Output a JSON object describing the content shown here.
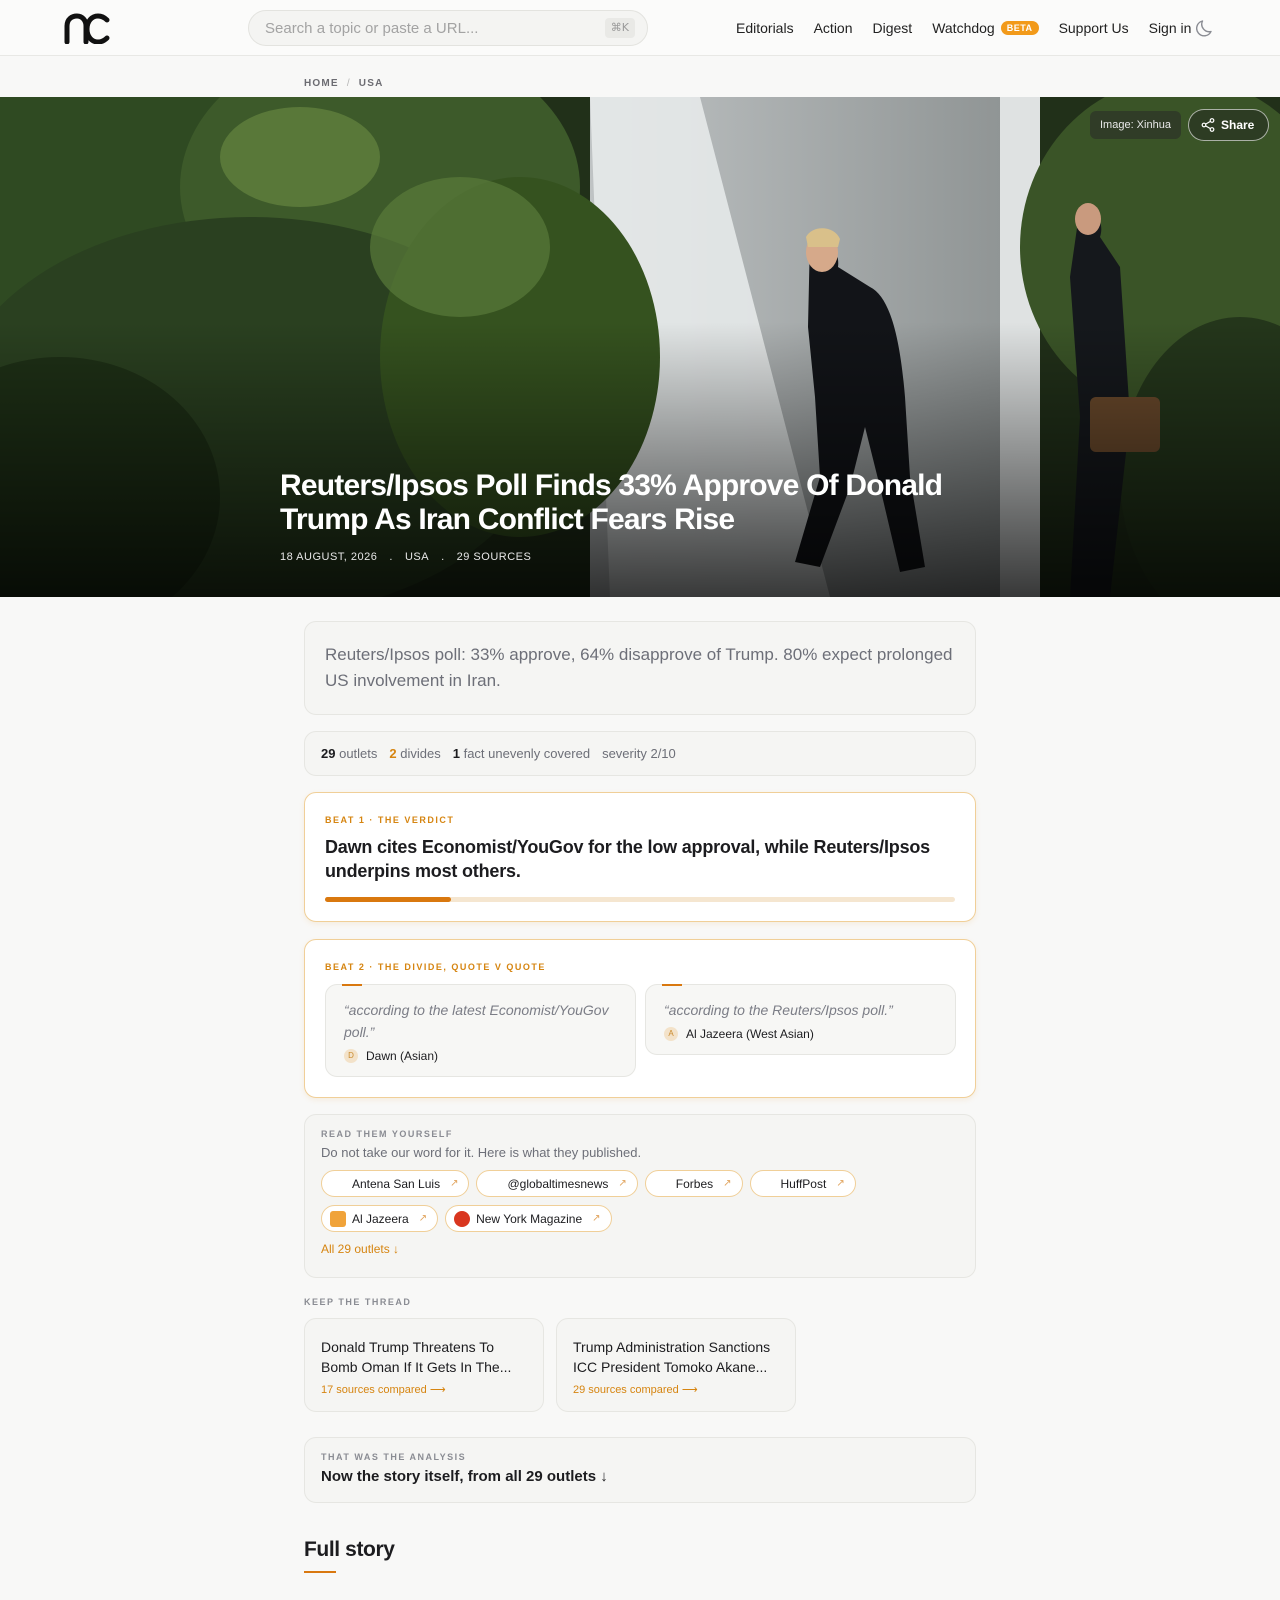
{
  "header": {
    "logo_text": "nc",
    "search_placeholder": "Search a topic or paste a URL...",
    "search_shortcut": "⌘K",
    "nav": [
      {
        "label": "Editorials"
      },
      {
        "label": "Action"
      },
      {
        "label": "Digest"
      },
      {
        "label": "Watchdog",
        "badge": "BETA"
      },
      {
        "label": "Support Us"
      },
      {
        "label": "Sign in"
      }
    ],
    "theme_icon": "moon-icon"
  },
  "breadcrumb": [
    "HOME",
    "/",
    "USA"
  ],
  "hero": {
    "image_credit": "Image: Xinhua",
    "share_label": "Share",
    "title": "Reuters/Ipsos Poll Finds 33% Approve Of Donald Trump As Iran Conflict Fears Rise",
    "meta": [
      "18 AUGUST, 2026",
      ".",
      "USA",
      ".",
      "29 SOURCES"
    ]
  },
  "summary": "Reuters/Ipsos poll: 33% approve, 64% disapprove of Trump. 80% expect prolonged US involvement in Iran.",
  "stats": {
    "outlets_count": "29",
    "outlets_label": "outlets",
    "divides_count": "2",
    "divides_label": "divides",
    "facts_count": "1",
    "facts_label": "fact unevenly covered",
    "severity": "severity 2/10"
  },
  "beat1": {
    "label": "BEAT 1 · THE VERDICT",
    "text": "Dawn cites Economist/YouGov for the low approval, while Reuters/Ipsos underpins most others.",
    "progress": 0.2
  },
  "beat2": {
    "label": "BEAT 2 · THE DIVIDE, QUOTE V QUOTE",
    "quotes": [
      {
        "text": "“according to the latest Economist/YouGov poll.”",
        "source": "Dawn (Asian)",
        "initial": "D"
      },
      {
        "text": "“according to the Reuters/Ipsos poll.”",
        "source": "Al Jazeera (West Asian)",
        "initial": "A"
      }
    ]
  },
  "read": {
    "label": "READ THEM YOURSELF",
    "subtitle": "Do not take our word for it. Here is what they published.",
    "outlets": [
      {
        "name": "Antena San Luis",
        "fav_color": "#ffffff"
      },
      {
        "name": "@globaltimesnews",
        "fav_color": "#ffffff"
      },
      {
        "name": "Forbes",
        "fav_color": "#ffffff"
      },
      {
        "name": "HuffPost",
        "fav_color": "#ffffff"
      },
      {
        "name": "Al Jazeera",
        "fav_color": "#f0a33a"
      },
      {
        "name": "New York Magazine",
        "fav_color": "#d9361f"
      }
    ],
    "arrow": "↗",
    "all_link": "All 29 outlets ↓"
  },
  "keep": {
    "label": "KEEP THE THREAD",
    "items": [
      {
        "title": "Donald Trump Threatens To Bomb Oman If It Gets In The...",
        "sources": "17 sources compared ⟶"
      },
      {
        "title": "Trump Administration Sanctions ICC President Tomoko Akane...",
        "sources": "29 sources compared ⟶"
      }
    ]
  },
  "analysis": {
    "label": "THAT WAS THE ANALYSIS",
    "text": "Now the story itself, from all 29 outlets ↓"
  },
  "full_story": "Full story",
  "colors": {
    "accent": "#d9780f",
    "beta": "#f29a1a",
    "border_warm": "#f0cf98"
  }
}
